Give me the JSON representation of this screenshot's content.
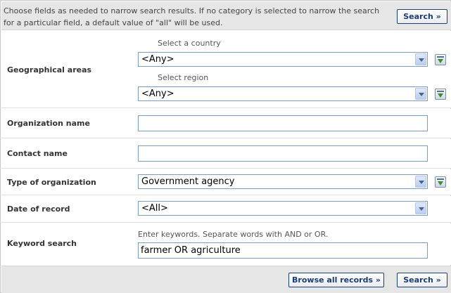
{
  "header": {
    "intro": "Choose fields as needed to narrow search results. If no category is selected to narrow the search for a particular field, a default value of \"all\" will be used.",
    "search_label": "Search »"
  },
  "fields": {
    "geo": {
      "label": "Geographical areas",
      "country_label": "Select a country",
      "country_value": "<Any>",
      "region_label": "Select region",
      "region_value": "<Any>"
    },
    "org_name": {
      "label": "Organization name",
      "value": ""
    },
    "contact_name": {
      "label": "Contact name",
      "value": ""
    },
    "org_type": {
      "label": "Type of organization",
      "value": "Government agency"
    },
    "date": {
      "label": "Date of record",
      "value": "<All>"
    },
    "keyword": {
      "label": "Keyword search",
      "hint": "Enter keywords. Separate words with AND or OR.",
      "value": "farmer OR agriculture"
    }
  },
  "footer": {
    "browse_label": "Browse all records »",
    "search_label": "Search »"
  },
  "icons": {
    "add": "add-to-list-icon"
  }
}
